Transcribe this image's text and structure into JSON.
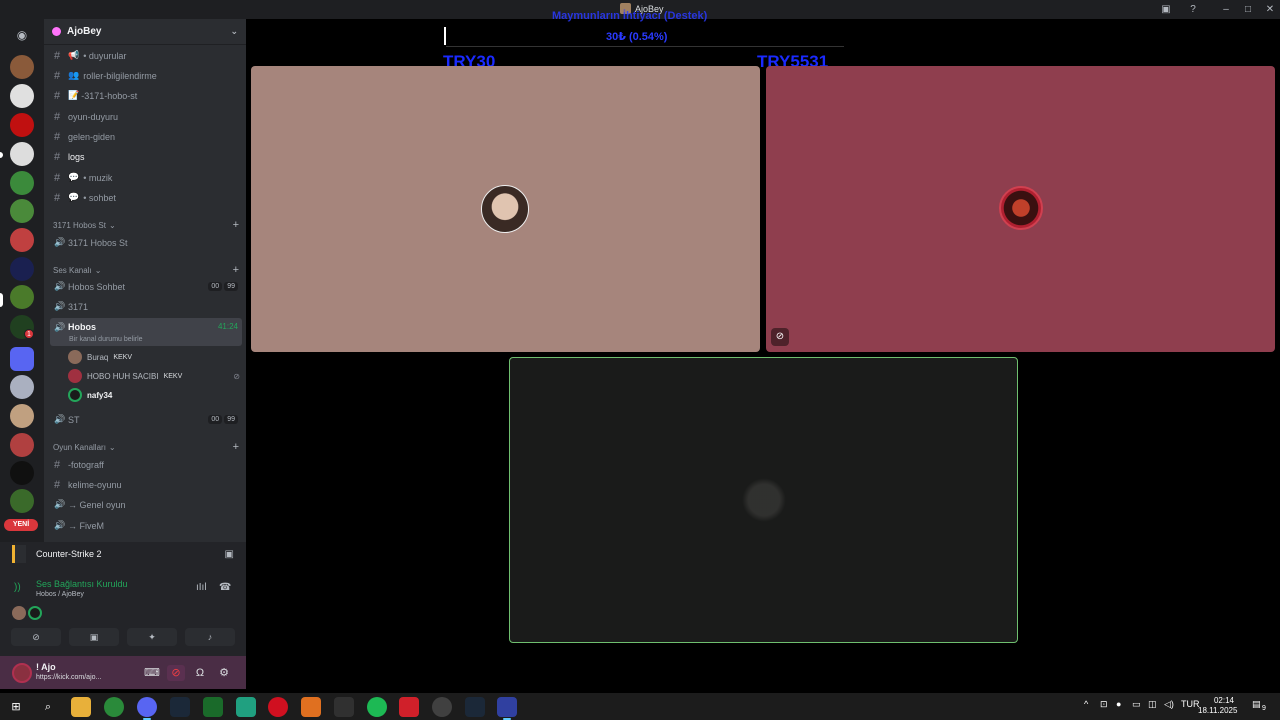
{
  "window": {
    "title": "AjoBey"
  },
  "server": {
    "name": "AjoBey"
  },
  "channels": {
    "text": [
      {
        "name": "• duyurular",
        "emoji": "📢"
      },
      {
        "name": "roller-bilgilendirme",
        "emoji": "👥"
      },
      {
        "name": "-3171-hobo-st",
        "emoji": "📝"
      },
      {
        "name": "oyun-duyuru",
        "emoji": ""
      },
      {
        "name": "gelen-giden",
        "emoji": ""
      },
      {
        "name": "logs",
        "emoji": ""
      },
      {
        "name": "• muzik",
        "emoji": "💬"
      },
      {
        "name": "• sohbet",
        "emoji": "💬"
      }
    ],
    "cat1": "3171 Hobos St",
    "cat1_channel": "3171 Hobos St",
    "cat2": "Ses Kanalı",
    "voice": [
      {
        "name": "Hobos Sohbet",
        "c1": "00",
        "c2": "99"
      },
      {
        "name": "3171"
      },
      {
        "name": "Hobos",
        "time": "41:24"
      }
    ],
    "status_line": "Bir kanal durumu belirle",
    "voice_users": [
      {
        "name": "Buraq",
        "tag": "KEKV"
      },
      {
        "name": "HOBO HUH SACIBI",
        "tag": "KEKV"
      },
      {
        "name": "nafy34",
        "tag": ""
      }
    ],
    "st": {
      "name": "ST",
      "c1": "00",
      "c2": "99"
    },
    "cat3": "Oyun Kanalları",
    "game": [
      {
        "name": "-fotograff",
        "kind": "text"
      },
      {
        "name": "kelime-oyunu",
        "kind": "text"
      },
      {
        "name": "→ Genel oyun",
        "kind": "voice"
      },
      {
        "name": "→ FiveM",
        "kind": "voice"
      }
    ]
  },
  "rail": {
    "new_label": "YENİ",
    "badge": "1"
  },
  "activity": {
    "game": "Counter-Strike 2"
  },
  "voice_panel": {
    "status": "Ses Bağlantısı Kuruldu",
    "location": "Hobos / AjoBey"
  },
  "user": {
    "name": "! Ajo",
    "sub": "https://kick.com/ajo..."
  },
  "overlay": {
    "title": "Maymunların İhtiyacı (Destek)",
    "amount": "30₺ (0.54%)",
    "left": "TRY30",
    "right": "TRY5531"
  },
  "taskbar": {
    "lang": "TUR",
    "time": "02:14",
    "date": "18.11.2025",
    "notif": "9"
  },
  "colors": {
    "accent_green": "#23a55a",
    "tile1": "#a6857c",
    "tile2": "#8f3e4e",
    "overlay_blue": "#1a2aff"
  }
}
